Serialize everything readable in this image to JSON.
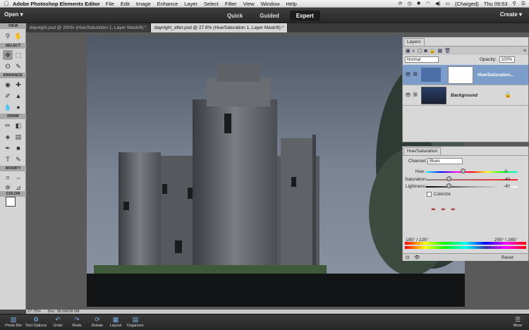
{
  "menubar": {
    "app_name": "Adobe Photoshop Elements Editor",
    "items": [
      "File",
      "Edit",
      "Image",
      "Enhance",
      "Layer",
      "Select",
      "Filter",
      "View",
      "Window",
      "Help"
    ],
    "battery": "(Charged)",
    "clock": "Thu 09:53"
  },
  "appbar": {
    "open_label": "Open ▾",
    "modes": [
      {
        "label": "Quick",
        "active": false
      },
      {
        "label": "Guided",
        "active": false
      },
      {
        "label": "Expert",
        "active": true
      }
    ],
    "create_label": "Create ▾"
  },
  "doc_tabs": [
    {
      "label": "daynight.psd @ 200% (Hue/Saturation 1, Layer Mask/8) *",
      "active": false
    },
    {
      "label": "daynight_after.psd @ 27.8% (Hue/Saturation 1, Layer Mask/8) *",
      "active": true
    }
  ],
  "toolbar": {
    "sections": {
      "view": "VIEW",
      "select": "SELECT",
      "enhance": "ENHANCE",
      "draw": "DRAW",
      "modify": "MODIFY",
      "color": "COLOR"
    }
  },
  "layers_panel": {
    "tab_label": "Layers",
    "blend_mode": "Normal",
    "opacity_label": "Opacity:",
    "opacity_value": "100%",
    "layers": [
      {
        "name": "Hue/Saturation...",
        "selected": true
      },
      {
        "name": "Background",
        "selected": false
      }
    ]
  },
  "hue_panel": {
    "tab_label": "Hue/Saturation",
    "channel_label": "Channel:",
    "channel_value": "Blues",
    "hue_label": "Hue:",
    "hue_value": "0",
    "saturation_label": "Saturation:",
    "saturation_value": "-40",
    "lightness_label": "Lightness:",
    "lightness_value": "-40",
    "colorize_label": "Colorize",
    "range_left": "195° / 225°",
    "range_right": "255° \\ 285°",
    "reset_label": "Reset"
  },
  "statusbar": {
    "zoom": "27.75%",
    "doc_info": "Doc: 38.0M/38.0M"
  },
  "bottombar": {
    "buttons": [
      {
        "label": "Photo Bin",
        "icon": "photo-bin-icon"
      },
      {
        "label": "Tool Options",
        "icon": "tool-options-icon"
      },
      {
        "label": "Undo",
        "icon": "undo-icon"
      },
      {
        "label": "Redo",
        "icon": "redo-icon"
      },
      {
        "label": "Rotate",
        "icon": "rotate-icon"
      },
      {
        "label": "Layout",
        "icon": "layout-icon"
      },
      {
        "label": "Organizer",
        "icon": "organizer-icon"
      }
    ],
    "more_label": "More"
  }
}
